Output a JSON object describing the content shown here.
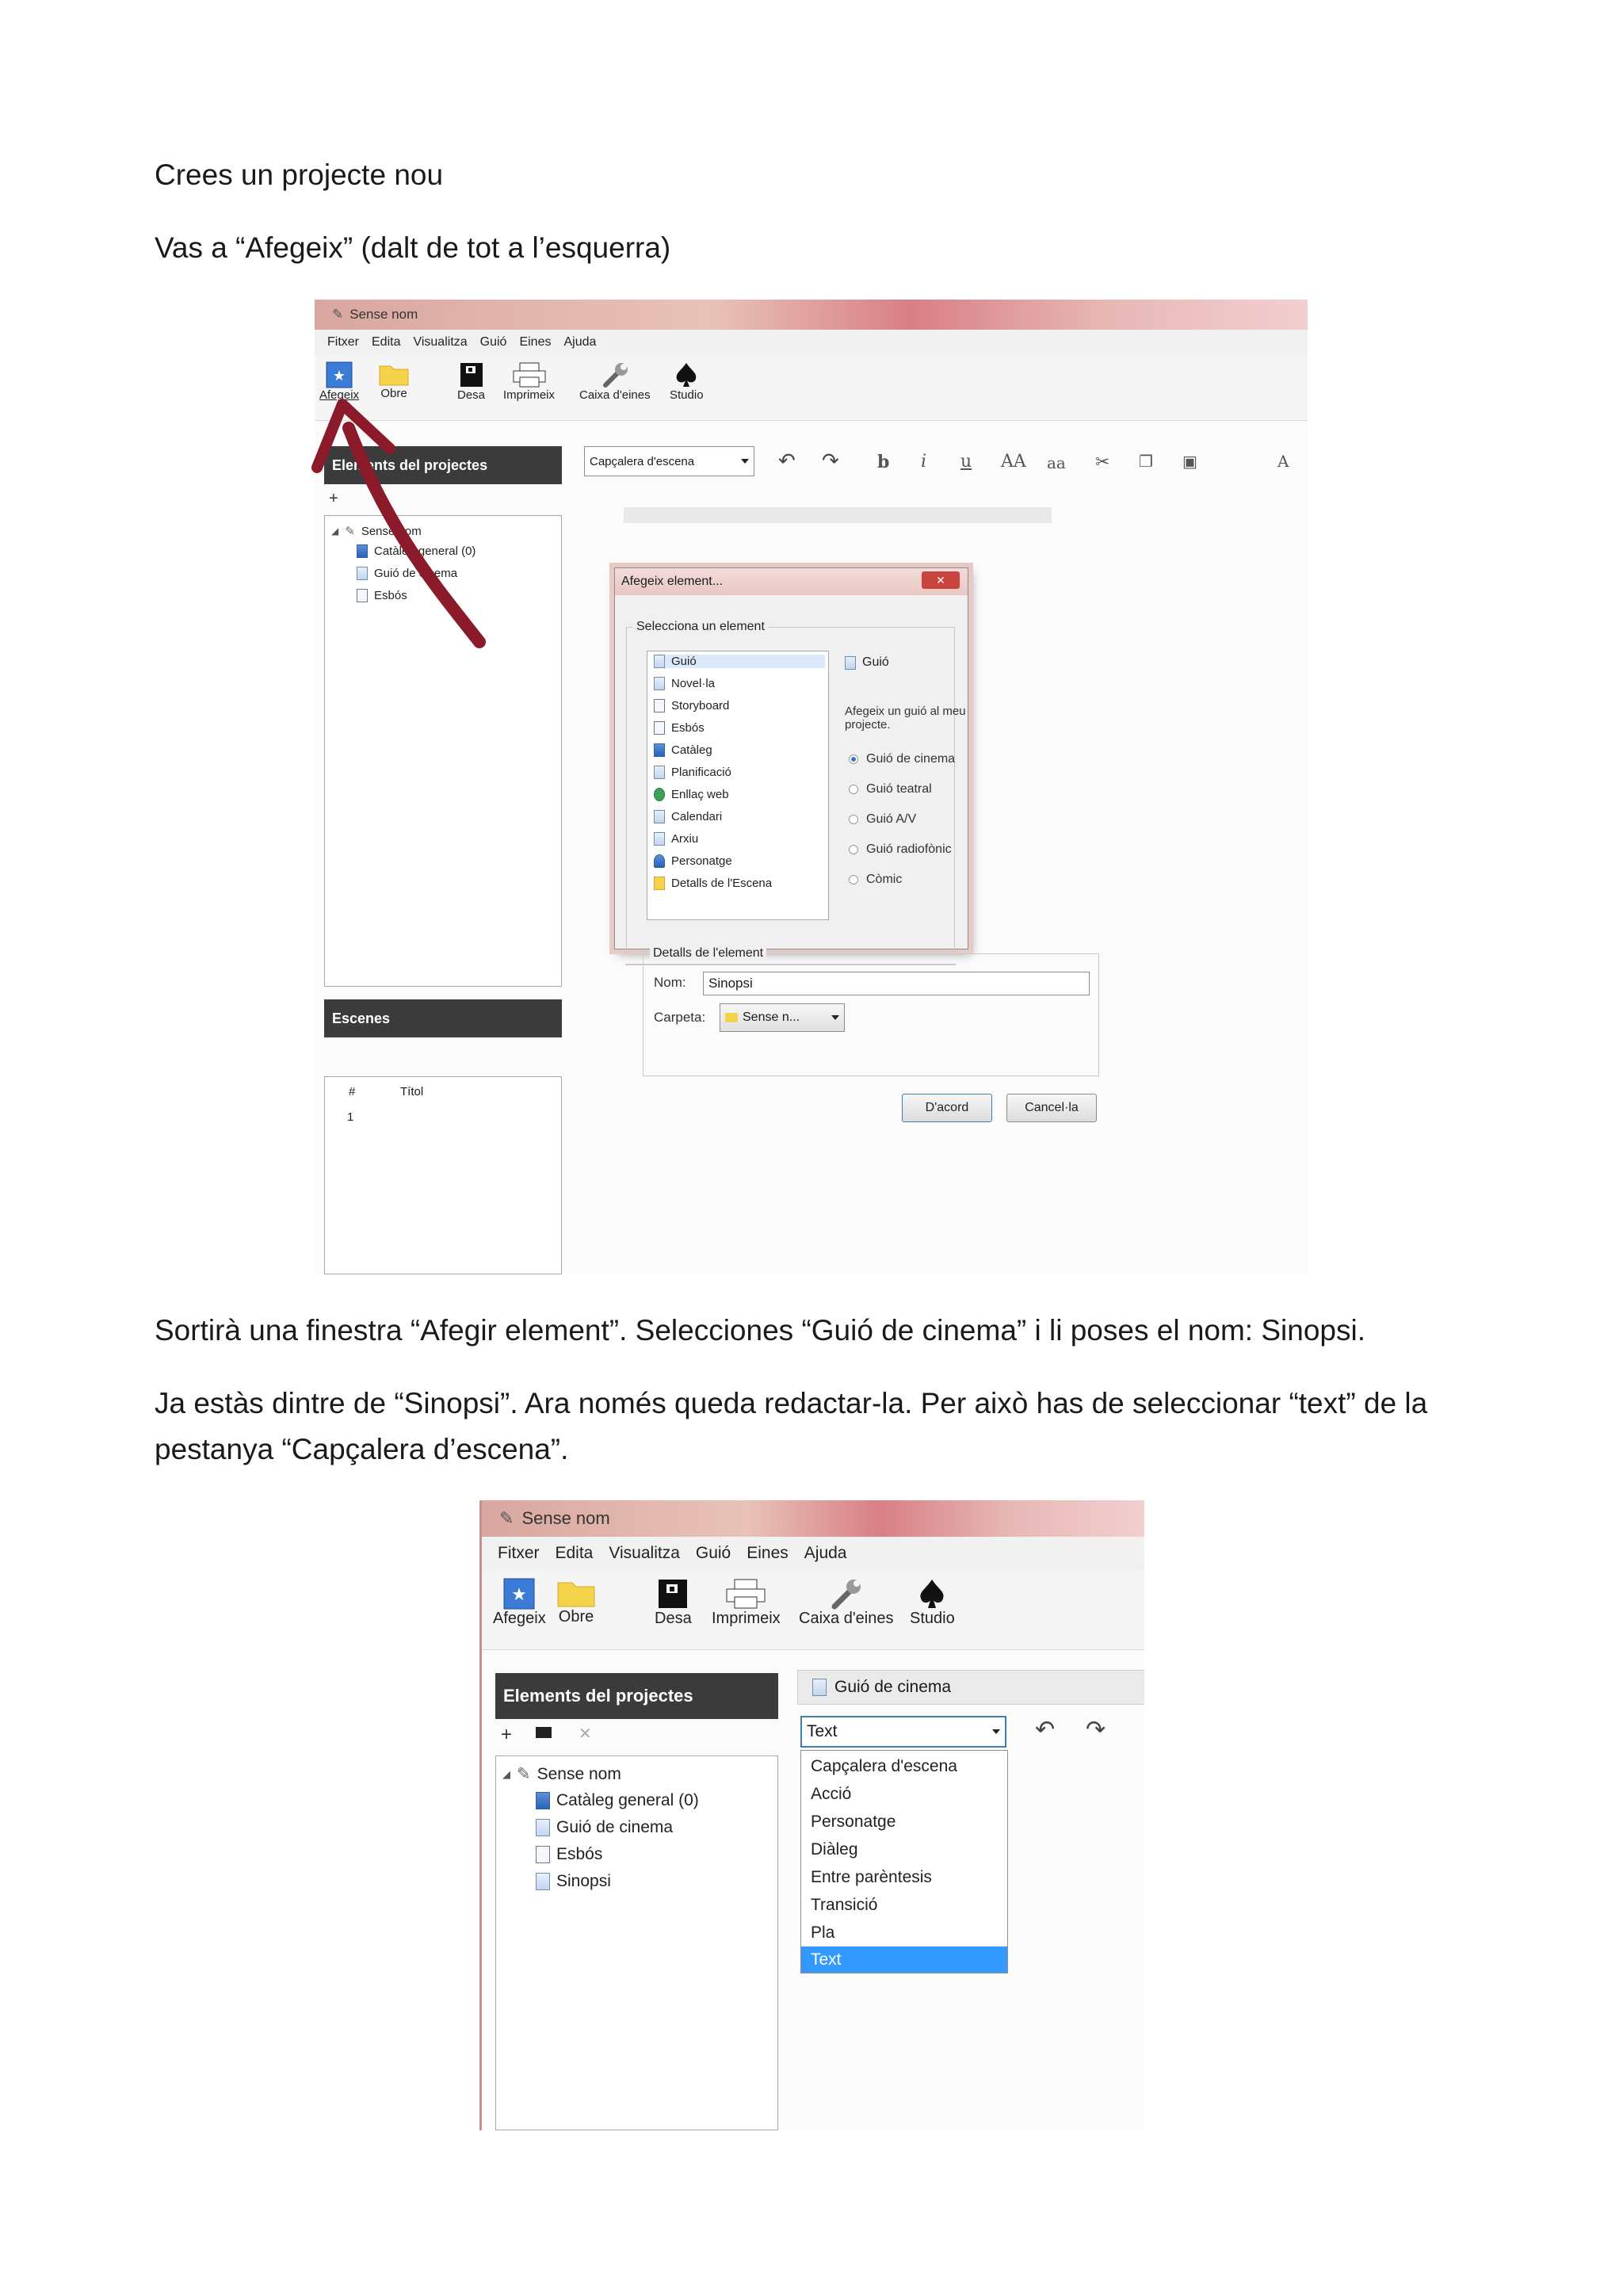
{
  "doc": {
    "p1": "Crees un projecte nou",
    "p2": "Vas a “Afegeix”  (dalt de tot a l’esquerra)",
    "p3": "Sortirà una finestra “Afegir element”. Selecciones “Guió de cinema” i li poses el nom: Sinopsi.",
    "p4_line1": "Ja estàs dintre de “Sinopsi”. Ara només queda redactar-la. Per això has de seleccionar “text” de la",
    "p4_line2": "pestanya “Capçalera d’escena”."
  },
  "app": {
    "title": "Sense nom",
    "menu": [
      "Fitxer",
      "Edita",
      "Visualitza",
      "Guió",
      "Eines",
      "Ajuda"
    ],
    "toolbar": [
      "Afegeix",
      "Obre",
      "Desa",
      "Imprimeix",
      "Caixa d'eines",
      "Studio"
    ],
    "projects_panel_title": "Elements del projectes",
    "tree": {
      "root": "Sense nom",
      "children": [
        "Catàleg general (0)",
        "Guió de cinema",
        "Esbós",
        "Sinopsi"
      ]
    },
    "scenes_panel_title": "Escenes",
    "scenes_columns": [
      "#",
      "Títol"
    ],
    "scenes_rows": [
      "1"
    ],
    "style_combo_value": "Capçalera d'escena",
    "format_buttons": [
      "b",
      "i",
      "u",
      "AA",
      "aa",
      "A"
    ]
  },
  "dialog": {
    "title": "Afegeix element...",
    "group1_label": "Selecciona un element",
    "items": [
      "Guió",
      "Novel·la",
      "Storyboard",
      "Esbós",
      "Catàleg",
      "Planificació",
      "Enllaç web",
      "Calendari",
      "Arxiu",
      "Personatge",
      "Detalls de l'Escena"
    ],
    "selected_title": "Guió",
    "description": "Afegeix un guió al meu projecte.",
    "options": [
      "Guió de cinema",
      "Guió teatral",
      "Guió A/V",
      "Guió radiofònic",
      "Còmic"
    ],
    "selected_option": 0,
    "group2_label": "Detalls de l'element",
    "name_label": "Nom:",
    "name_value": "Sinopsi",
    "folder_label": "Carpeta:",
    "folder_value": "Sense n...",
    "ok": "D'acord",
    "cancel": "Cancel·la",
    "close": "✕"
  },
  "shot2": {
    "tab_label": "Guió de cinema",
    "combo_value": "Text",
    "dropdown": [
      "Capçalera d'escena",
      "Acció",
      "Personatge",
      "Diàleg",
      "Entre parèntesis",
      "Transició",
      "Pla",
      "Text"
    ],
    "dropdown_selected": 7
  },
  "colors": {
    "annotation_arrow": "#8b1a2b",
    "selection": "#3399ff",
    "panel_header": "#3b3b3b"
  },
  "icons": [
    "add-star-icon",
    "folder-icon",
    "save-disk-icon",
    "printer-icon",
    "wrench-icon",
    "spade-icon",
    "undo-icon",
    "redo-icon"
  ]
}
